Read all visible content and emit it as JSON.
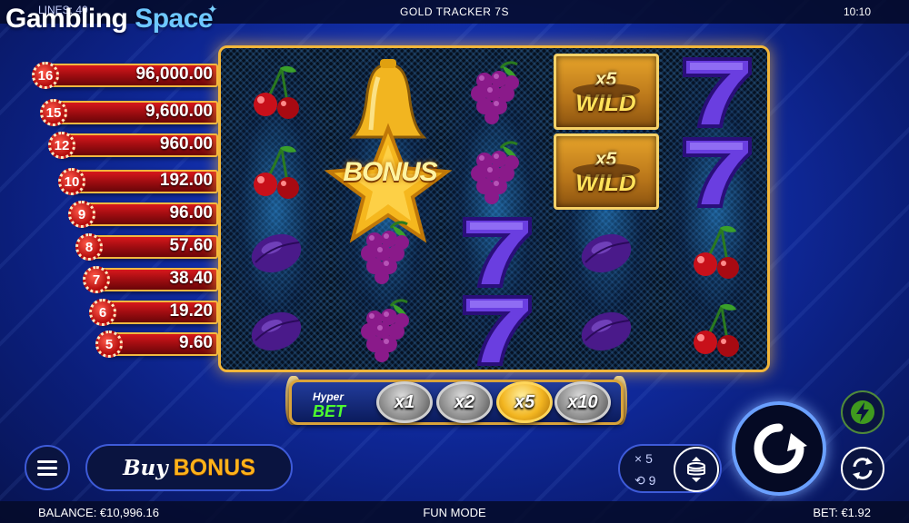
{
  "top_bar": {
    "lines_text": "LINES: 40",
    "game_title": "GOLD TRACKER 7S",
    "clock": "10:10"
  },
  "brand": {
    "part1": "Gambling",
    "part2": "Space"
  },
  "paytable": [
    {
      "count": "16",
      "amount": "96,000.00"
    },
    {
      "count": "15",
      "amount": "9,600.00"
    },
    {
      "count": "12",
      "amount": "960.00"
    },
    {
      "count": "10",
      "amount": "192.00"
    },
    {
      "count": "9",
      "amount": "96.00"
    },
    {
      "count": "8",
      "amount": "57.60"
    },
    {
      "count": "7",
      "amount": "38.40"
    },
    {
      "count": "6",
      "amount": "19.20"
    },
    {
      "count": "5",
      "amount": "9.60"
    }
  ],
  "reels": {
    "bonus_text": "BONUS",
    "wild_multiplier": "x5",
    "wild_text": "WILD",
    "grid": [
      [
        "cherry",
        "cherry",
        "plum",
        "plum"
      ],
      [
        "bell",
        "bonus-star",
        "grapes",
        "grapes"
      ],
      [
        "grapes",
        "grapes",
        "seven",
        "seven"
      ],
      [
        "wild",
        "wild",
        "plum",
        "plum"
      ],
      [
        "seven",
        "seven",
        "cherry",
        "cherry"
      ]
    ]
  },
  "hyper_bet": {
    "logo_line1": "Hyper",
    "logo_line2": "BET",
    "options": [
      "x1",
      "x2",
      "x5",
      "x10"
    ],
    "selected": "x5"
  },
  "controls": {
    "buy_label": "Buy",
    "bonus_label": "BONUS",
    "multiplier_row": "× 5",
    "coin_row": "9",
    "icons": [
      "menu-icon",
      "coin-stack-icon",
      "spin-icon",
      "lightning-icon",
      "autoplay-icon"
    ]
  },
  "bottom_bar": {
    "balance": "BALANCE: €10,996.16",
    "mode": "FUN MODE",
    "bet": "BET: €1.92"
  },
  "colors": {
    "accent_gold": "#f2b63a",
    "paytable_red": "#c5141a",
    "bonus_orange": "#ffb21a",
    "hyper_green": "#4dff2e"
  }
}
